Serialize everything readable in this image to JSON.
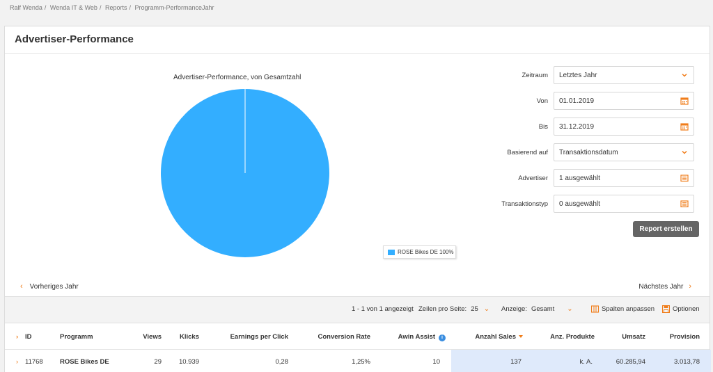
{
  "breadcrumb": [
    "Ralf Wenda",
    "Wenda IT & Web",
    "Reports",
    "Programm-PerformanceJahr"
  ],
  "page_title": "Advertiser-Performance",
  "chart_data": {
    "type": "pie",
    "title": "Advertiser-Performance, von Gesamtzahl",
    "slices": [
      {
        "name": "ROSE Bikes DE",
        "value": 100,
        "color": "#33aeff"
      }
    ],
    "legend": [
      "ROSE Bikes DE 100%"
    ],
    "legend_position": "bottom-right"
  },
  "form": {
    "zeitraum": {
      "label": "Zeitraum",
      "value": "Letztes Jahr"
    },
    "von": {
      "label": "Von",
      "value": "01.01.2019"
    },
    "bis": {
      "label": "Bis",
      "value": "31.12.2019"
    },
    "basierend": {
      "label": "Basierend auf",
      "value": "Transaktionsdatum"
    },
    "advertiser": {
      "label": "Advertiser",
      "value": "1 ausgewählt"
    },
    "transaktionstyp": {
      "label": "Transaktionstyp",
      "value": "0 ausgewählt"
    },
    "submit": "Report erstellen"
  },
  "nav": {
    "prev": "Vorheriges Jahr",
    "next": "Nächstes Jahr"
  },
  "toolbar": {
    "count": "1 - 1 von 1 angezeigt",
    "rows_label": "Zeilen pro Seite:",
    "rows_value": "25",
    "anzeige_label": "Anzeige:",
    "anzeige_value": "Gesamt",
    "spalten": "Spalten anpassen",
    "optionen": "Optionen"
  },
  "table": {
    "headers": {
      "id": "ID",
      "programm": "Programm",
      "views": "Views",
      "klicks": "Klicks",
      "epc": "Earnings per Click",
      "cr": "Conversion Rate",
      "awin": "Awin Assist",
      "sales": "Anzahl Sales",
      "produkte": "Anz. Produkte",
      "umsatz": "Umsatz",
      "provision": "Provision"
    },
    "rows": [
      {
        "id": "11768",
        "programm": "ROSE Bikes DE",
        "views": "29",
        "klicks": "10.939",
        "epc": "0,28",
        "cr": "1,25%",
        "awin": "10",
        "sales": "137",
        "produkte": "k. A.",
        "umsatz": "60.285,94",
        "provision": "3.013,78"
      }
    ]
  },
  "colors": {
    "accent": "#f07d1a",
    "pie": "#33aeff",
    "highlight": "#dfeafb",
    "button": "#656565"
  }
}
